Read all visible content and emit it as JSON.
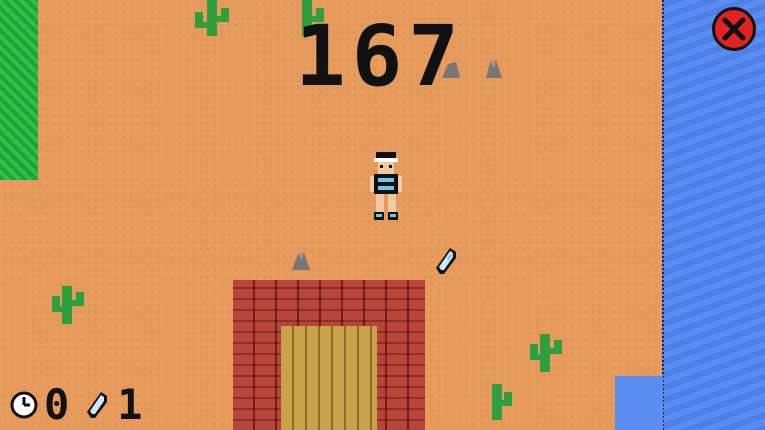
{
  "game": {
    "score": "167",
    "clock_count": "0",
    "crystal_count": "1"
  },
  "icons": {
    "close": "close-icon",
    "clock": "clock-icon",
    "crystal": "crystal-icon"
  },
  "colors": {
    "sand": "#e69b5c",
    "water": "#5b8cf0",
    "grass": "#2bc24a",
    "cactus": "#2e9e3e",
    "brick": "#b8453a",
    "door": "#c9a24a",
    "close_button": "#e02222"
  }
}
